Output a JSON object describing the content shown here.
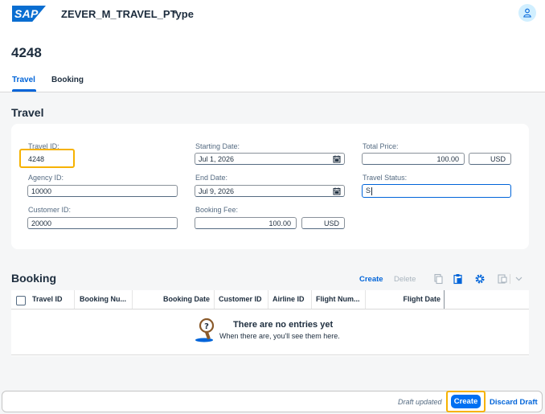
{
  "shell": {
    "logo": "SAP",
    "app_title": "ZEVER_M_TRAVEL_PType"
  },
  "header": {
    "object_title": "4248",
    "tabs": [
      "Travel",
      "Booking"
    ]
  },
  "travel_section": {
    "title": "Travel",
    "fields": {
      "travel_id": {
        "label": "Travel ID:",
        "value": "4248"
      },
      "agency_id": {
        "label": "Agency ID:",
        "value": "10000"
      },
      "customer_id": {
        "label": "Customer ID:",
        "value": "20000"
      },
      "starting_date": {
        "label": "Starting Date:",
        "value": "Jul 1, 2026"
      },
      "end_date": {
        "label": "End Date:",
        "value": "Jul 9, 2026"
      },
      "booking_fee": {
        "label": "Booking Fee:",
        "value": "100.00",
        "currency": "USD"
      },
      "total_price": {
        "label": "Total Price:",
        "value": "100.00",
        "currency": "USD"
      },
      "travel_status": {
        "label": "Travel Status:",
        "value": "S"
      }
    }
  },
  "booking_section": {
    "title": "Booking",
    "toolbar": {
      "create": "Create",
      "delete": "Delete"
    },
    "columns": [
      "Travel ID",
      "Booking Nu...",
      "Booking Date",
      "Customer ID",
      "Airline ID",
      "Flight Num...",
      "Flight Date"
    ],
    "empty_title": "There are no entries yet",
    "empty_text": "When there are, you'll see them here."
  },
  "footer": {
    "status": "Draft updated",
    "create": "Create",
    "discard": "Discard Draft"
  },
  "colors": {
    "brand": "#0a6ed1",
    "accent": "#0070f2",
    "highlight": "#f6b200"
  }
}
